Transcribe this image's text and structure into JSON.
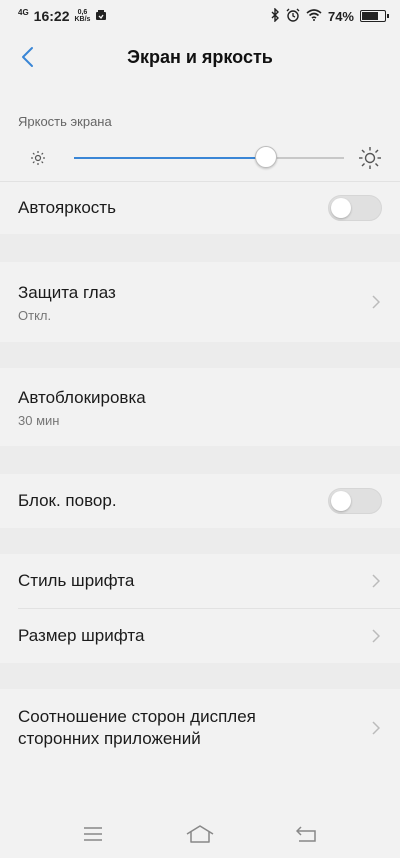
{
  "status": {
    "network": "4G",
    "time": "16:22",
    "speed_value": "0,6",
    "speed_unit": "KB/s",
    "battery": "74%",
    "battery_level": 0.74
  },
  "header": {
    "title": "Экран и яркость"
  },
  "brightness": {
    "caption": "Яркость экрана",
    "level": 0.71
  },
  "auto_brightness": {
    "label": "Автояркость",
    "on": false
  },
  "eye_protection": {
    "label": "Защита глаз",
    "value": "Откл."
  },
  "auto_lock": {
    "label": "Автоблокировка",
    "value": "30 мин"
  },
  "rotation_lock": {
    "label": "Блок. повор.",
    "on": false
  },
  "font_style": {
    "label": "Стиль шрифта"
  },
  "font_size": {
    "label": "Размер шрифта"
  },
  "aspect_ratio": {
    "label_line1": "Соотношение сторон дисплея",
    "label_line2": "сторонних приложений"
  },
  "colors": {
    "accent": "#3a86d6"
  }
}
